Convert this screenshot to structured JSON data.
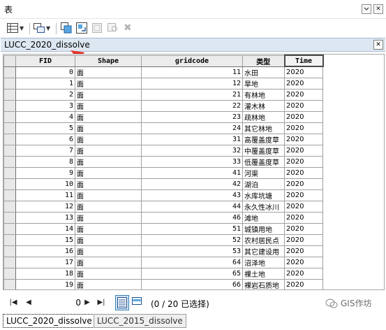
{
  "window": {
    "title": "表"
  },
  "table_name": "LUCC_2020_dissolve",
  "columns": [
    "FID",
    "Shape",
    "gridcode",
    "类型",
    "Time"
  ],
  "rows": [
    {
      "fid": "0",
      "shape": "面",
      "gridcode": "11",
      "type": "水田",
      "time": "2020"
    },
    {
      "fid": "1",
      "shape": "面",
      "gridcode": "12",
      "type": "旱地",
      "time": "2020"
    },
    {
      "fid": "2",
      "shape": "面",
      "gridcode": "21",
      "type": "有林地",
      "time": "2020"
    },
    {
      "fid": "3",
      "shape": "面",
      "gridcode": "22",
      "type": "灌木林",
      "time": "2020"
    },
    {
      "fid": "4",
      "shape": "面",
      "gridcode": "23",
      "type": "疏林地",
      "time": "2020"
    },
    {
      "fid": "5",
      "shape": "面",
      "gridcode": "24",
      "type": "其它林地",
      "time": "2020"
    },
    {
      "fid": "6",
      "shape": "面",
      "gridcode": "31",
      "type": "高覆盖度草",
      "time": "2020"
    },
    {
      "fid": "7",
      "shape": "面",
      "gridcode": "32",
      "type": "中覆盖度草",
      "time": "2020"
    },
    {
      "fid": "8",
      "shape": "面",
      "gridcode": "33",
      "type": "低覆盖度草",
      "time": "2020"
    },
    {
      "fid": "9",
      "shape": "面",
      "gridcode": "41",
      "type": "河渠",
      "time": "2020"
    },
    {
      "fid": "10",
      "shape": "面",
      "gridcode": "42",
      "type": "湖泊",
      "time": "2020"
    },
    {
      "fid": "11",
      "shape": "面",
      "gridcode": "43",
      "type": "水库坑塘",
      "time": "2020"
    },
    {
      "fid": "12",
      "shape": "面",
      "gridcode": "44",
      "type": "永久性冰川",
      "time": "2020"
    },
    {
      "fid": "13",
      "shape": "面",
      "gridcode": "46",
      "type": "滩地",
      "time": "2020"
    },
    {
      "fid": "14",
      "shape": "面",
      "gridcode": "51",
      "type": "城镇用地",
      "time": "2020"
    },
    {
      "fid": "15",
      "shape": "面",
      "gridcode": "52",
      "type": "农村居民点",
      "time": "2020"
    },
    {
      "fid": "16",
      "shape": "面",
      "gridcode": "53",
      "type": "其它建设用",
      "time": "2020"
    },
    {
      "fid": "17",
      "shape": "面",
      "gridcode": "64",
      "type": "沼泽地",
      "time": "2020"
    },
    {
      "fid": "18",
      "shape": "面",
      "gridcode": "65",
      "type": "裸土地",
      "time": "2020"
    },
    {
      "fid": "19",
      "shape": "面",
      "gridcode": "66",
      "type": "裸岩石质地",
      "time": "2020"
    }
  ],
  "navigation": {
    "current_record": "0",
    "selection_text": "(0 / 20 已选择)"
  },
  "watermark": "GIS作坊",
  "bottom_tabs": [
    "LUCC_2020_dissolve",
    "LUCC_2015_dissolve"
  ],
  "icons": {
    "table_options": "table-options-icon",
    "related_tables": "related-tables-icon",
    "select_by_attributes": "select-by-attributes-icon",
    "switch_selection": "switch-selection-icon",
    "clear_selection": "clear-selection-icon",
    "zoom_to_selected": "zoom-to-selected-icon",
    "delete_selected": "delete-selected-icon"
  },
  "colors": {
    "arrow": "#e8332b",
    "header_bg": "#dde7f2",
    "active_view": "#cde4f7"
  }
}
